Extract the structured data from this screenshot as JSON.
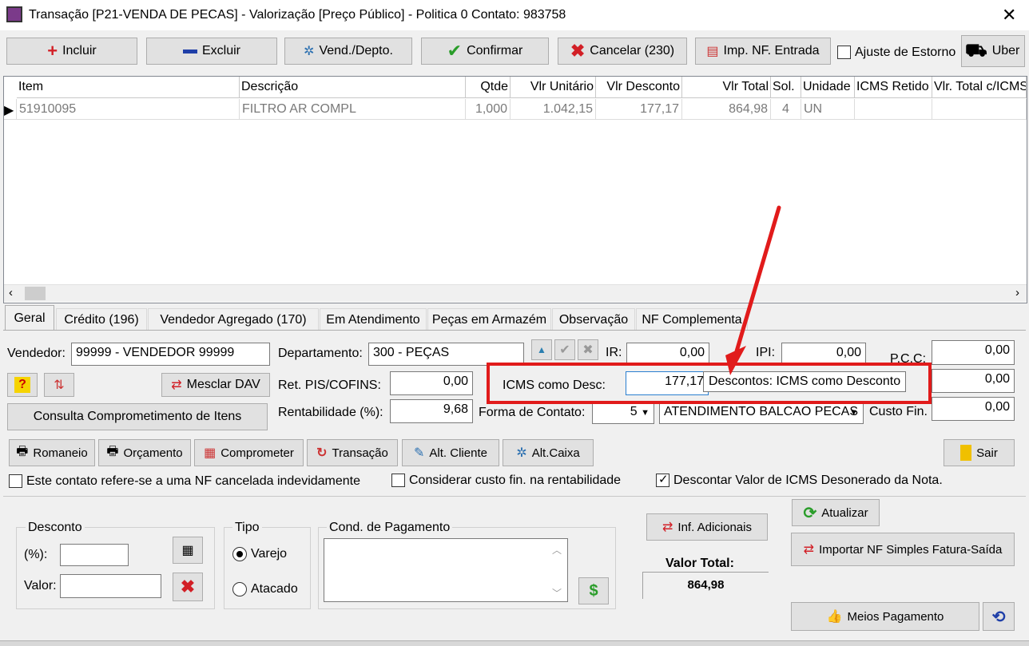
{
  "window": {
    "title": "Transação [P21-VENDA DE PECAS] - Valorização [Preço Público] - Politica 0  Contato: 983758"
  },
  "toolbar": {
    "incluir": "Incluir",
    "excluir": "Excluir",
    "vend_depto": "Vend./Depto.",
    "confirmar": "Confirmar",
    "cancelar": "Cancelar (230)",
    "imp_nf": "Imp. NF. Entrada",
    "ajuste_estorno": "Ajuste de Estorno",
    "uber": "Uber"
  },
  "grid": {
    "headers": [
      "Item",
      "Descrição",
      "Qtde",
      "Vlr Unitário",
      "Vlr Desconto",
      "Vlr Total",
      "Sol.",
      "Unidade",
      "ICMS Retido",
      "Vlr. Total c/ICMS"
    ],
    "rows": [
      [
        "51910095",
        "FILTRO AR COMPL",
        "1,000",
        "1.042,15",
        "177,17",
        "864,98",
        "4",
        "UN",
        "",
        ""
      ]
    ]
  },
  "tabs": [
    "Geral",
    "Crédito (196)",
    "Vendedor Agregado (170)",
    "Em Atendimento",
    "Peças em Armazém",
    "Observação",
    "NF Complementa"
  ],
  "geral": {
    "vendedor_label": "Vendedor:",
    "vendedor_value": "99999 - VENDEDOR 99999",
    "departamento_label": "Departamento:",
    "departamento_value": "300 - PEÇAS",
    "ir_label": "IR:",
    "ir_value": "0,00",
    "ipi_label": "IPI:",
    "ipi_value": "0,00",
    "pcc_label": "P.C.C:",
    "pcc_value": "0,00",
    "mesclar_dav": "Mesclar DAV",
    "ret_pis_label": "Ret. PIS/COFINS:",
    "ret_pis_value": "0,00",
    "icms_desc_label": "ICMS como Desc:",
    "icms_desc_value": "177,17",
    "tooltip": "Descontos: ICMS como Desconto",
    "right2_value": "0,00",
    "consulta_btn": "Consulta Comprometimento de Itens",
    "rentab_label": "Rentabilidade (%):",
    "rentab_value": "9,68",
    "forma_contato_label": "Forma de Contato:",
    "forma_contato_code": "5",
    "forma_contato_value": "ATENDIMENTO BALCAO PECAS",
    "custo_fin_label": "Custo Fin.",
    "custo_fin_value": "0,00"
  },
  "actions": {
    "romaneio": "Romaneio",
    "orcamento": "Orçamento",
    "comprometer": "Comprometer",
    "transacao": "Transação",
    "alt_cliente": "Alt. Cliente",
    "alt_caixa": "Alt.Caixa",
    "sair": "Sair"
  },
  "checks": {
    "nf_cancelada": "Este contato refere-se a uma NF cancelada indevidamente",
    "custo_fin": "Considerar custo fin. na rentabilidade",
    "descontar_icms": "Descontar Valor de ICMS Desonerado da Nota."
  },
  "bottom": {
    "desconto_title": "Desconto",
    "pct_label": "(%):",
    "valor_label": "Valor:",
    "tipo_title": "Tipo",
    "varejo": "Varejo",
    "atacado": "Atacado",
    "cond_pag_title": "Cond. de Pagamento",
    "inf_adicionais": "Inf. Adicionais",
    "valor_total_label": "Valor Total:",
    "valor_total_value": "864,98",
    "atualizar": "Atualizar",
    "importar_nf": "Importar NF Simples Fatura-Saída",
    "meios_pagamento": "Meios Pagamento"
  },
  "colors": {
    "highlight": "#e11b1b",
    "plus": "#d21f26",
    "minus": "#1f3fa8",
    "check": "#2a9d2a"
  }
}
